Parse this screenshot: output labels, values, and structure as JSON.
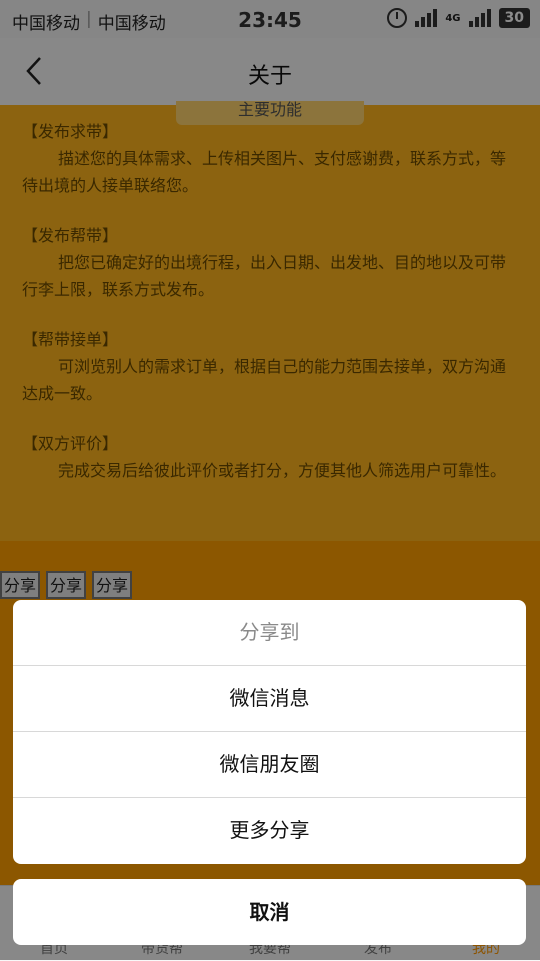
{
  "status_bar": {
    "carrier1": "中国移动",
    "carrier2": "中国移动",
    "time": "23:45",
    "network": "4G",
    "battery": "30"
  },
  "nav": {
    "title": "关于"
  },
  "content": {
    "section_header": "主要功能",
    "features": [
      {
        "title": "【发布求带】",
        "desc": "描述您的具体需求、上传相关图片、支付感谢费，联系方式，等待出境的人接单联络您。"
      },
      {
        "title": "【发布帮带】",
        "desc": "把您已确定好的出境行程，出入日期、出发地、目的地以及可带行李上限，联系方式发布。"
      },
      {
        "title": "【帮带接单】",
        "desc": "可浏览别人的需求订单，根据自己的能力范围去接单，双方沟通达成一致。"
      },
      {
        "title": "【双方评价】",
        "desc": "完成交易后给彼此评价或者打分，方便其他人筛选用户可靠性。"
      }
    ],
    "share_buttons": [
      "分享",
      "分享",
      "分享"
    ]
  },
  "tabs": [
    "首页",
    "带货帮",
    "我要帮",
    "发布",
    "我的"
  ],
  "action_sheet": {
    "title": "分享到",
    "options": [
      "微信消息",
      "微信朋友圈",
      "更多分享"
    ],
    "cancel": "取消"
  },
  "colors": {
    "content_bg": "#ffb41e",
    "accent": "#ff9800"
  }
}
